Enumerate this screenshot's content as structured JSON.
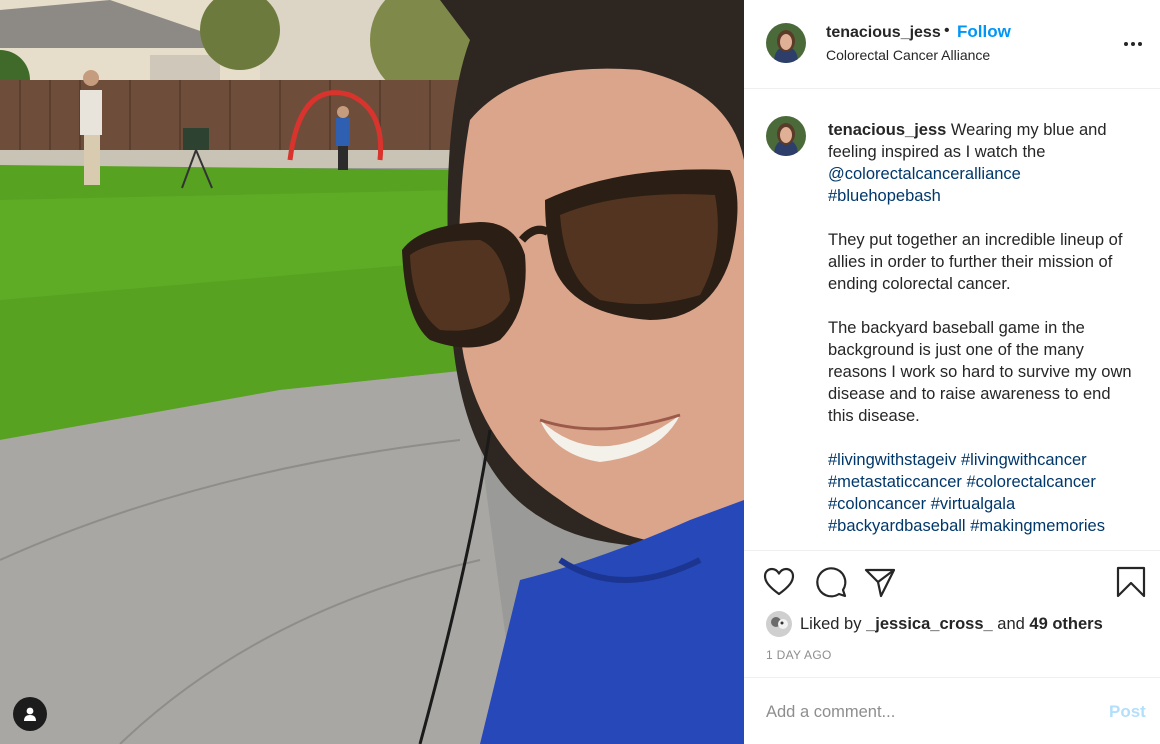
{
  "header": {
    "username": "tenacious_jess",
    "separator": "•",
    "follow_label": "Follow",
    "location": "Colorectal Cancer Alliance",
    "more_icon": "more-options-icon"
  },
  "caption": {
    "username": "tenacious_jess",
    "line1_text": "Wearing my blue and feeling inspired as I watch the",
    "mention": "@colorectalcanceralliance",
    "hashtag_intro": "#bluehopebash",
    "paragraph2": "They put together an incredible lineup of allies in order to further their mission of ending colorectal cancer.",
    "paragraph3": "The backyard baseball game in the background is just one of the many reasons I work so hard to survive my own disease and to raise awareness to end this disease.",
    "hashtags": [
      "#livingwithstageiv",
      "#livingwithcancer",
      "#metastaticcancer",
      "#colorectalcancer",
      "#coloncancer",
      "#virtualgala",
      "#backyardbaseball",
      "#makingmemories"
    ]
  },
  "actions": {
    "like_icon": "heart-icon",
    "comment_icon": "comment-icon",
    "share_icon": "share-icon",
    "save_icon": "bookmark-icon"
  },
  "likes": {
    "prefix": "Liked by",
    "liker": "_jessica_cross_",
    "and_text": "and",
    "others": "49 others"
  },
  "timestamp": "1 DAY AGO",
  "comment_box": {
    "placeholder": "Add a comment...",
    "post_label": "Post"
  },
  "colors": {
    "link": "#00376b",
    "follow": "#0095f6",
    "post_disabled": "#b2dffc",
    "muted": "#8e8e8e"
  }
}
